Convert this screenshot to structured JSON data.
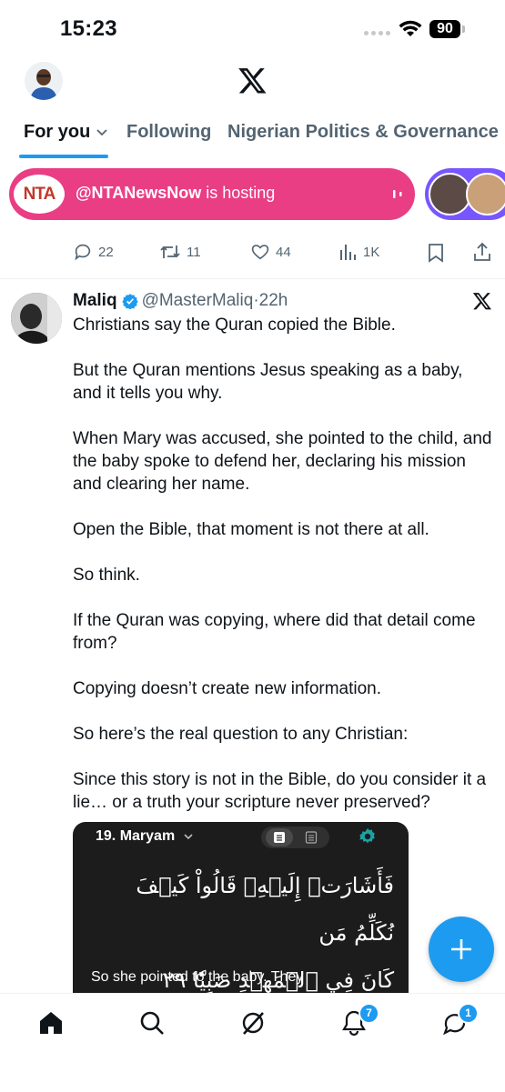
{
  "status_bar": {
    "time": "15:23",
    "battery": "90"
  },
  "tabs": [
    {
      "label": "For you",
      "active": true
    },
    {
      "label": "Following",
      "active": false
    },
    {
      "label": "Nigerian Politics & Governance",
      "active": false
    }
  ],
  "spaces": {
    "logo_text": "NTA",
    "host": "@NTANewsNow",
    "status": "is hosting"
  },
  "previous_tweet_actions": {
    "replies": "22",
    "reposts": "11",
    "likes": "44",
    "views": "1K"
  },
  "tweet": {
    "name": "Maliq",
    "handle": "@MasterMaliq",
    "separator": "·",
    "time": "22h",
    "paragraphs": [
      "Christians say the Quran copied the Bible.",
      "But the Quran mentions Jesus speaking as a baby, and it tells you why.",
      "When Mary was accused, she pointed to the child, and the baby spoke to defend her, declaring his mission and clearing her name.",
      "Open the Bible, that moment is not there at all.",
      "So think.",
      "If the Quran was copying, where did that detail come from?",
      "Copying doesn’t create new information.",
      "So here’s the real question to any Christian:",
      "Since this story is not in the Bible, do you consider it a lie… or a truth your scripture never preserved?"
    ],
    "media": {
      "surah_title": "19. Maryam",
      "arabic_line_1": "فَأَشَارَتۡ إِلَيۡهِۖ قَالُواْ كَيۡفَ نُكَلِّمُ مَن",
      "arabic_line_2": "كَانَ فِي ٱلۡمَهۡدِ صَبِيّٗا ٢٩",
      "caption": "So she pointed to the baby. They"
    }
  },
  "bottom_nav": {
    "notifications_badge": "7",
    "messages_badge": "1"
  },
  "colors": {
    "accent": "#1d9bf0",
    "spaces": "#e93e84",
    "spaces_purple": "#7856ff",
    "secondary_text": "#536471"
  }
}
